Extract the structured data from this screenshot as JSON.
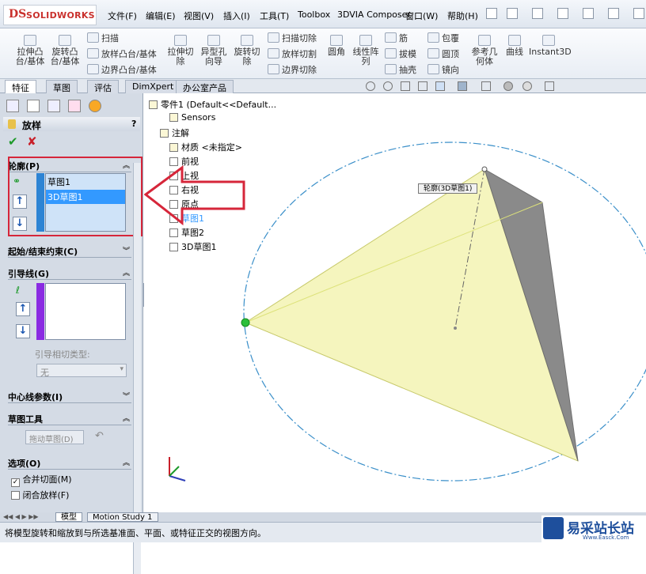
{
  "app": {
    "logo_ds": "DS",
    "logo_text": "SOLIDWORKS"
  },
  "menu": {
    "file": "文件(F)",
    "edit": "编辑(E)",
    "view": "视图(V)",
    "insert": "插入(I)",
    "tools": "工具(T)",
    "toolbox": "Toolbox",
    "dvia": "3DVIA Composer",
    "window": "窗口(W)",
    "help": "帮助(H)"
  },
  "ribbon": {
    "boss_extrude": "拉伸凸\n台/基体",
    "revolve_boss": "旋转凸\n台/基体",
    "sweep": "扫描",
    "loft_boss": "放样凸台/基体",
    "boundary_boss": "边界凸台/基体",
    "extrude_cut": "拉伸切\n除",
    "hole_wizard": "异型孔\n向导",
    "revolve_cut": "旋转切\n除",
    "sweep_cut": "扫描切除",
    "loft_cut": "放样切割",
    "boundary_cut": "边界切除",
    "fillet": "圆角",
    "linear_pattern": "线性阵\n列",
    "rib": "筋",
    "draft": "拔模",
    "shell": "抽壳",
    "wrap": "包覆",
    "dome": "圆顶",
    "mirror": "镜向",
    "ref_geometry": "参考几\n何体",
    "curves": "曲线",
    "instant3d": "Instant3D"
  },
  "tabs": [
    "特征",
    "草图",
    "评估",
    "DimXpert",
    "办公室产品"
  ],
  "panel": {
    "title": "放样",
    "help": "?",
    "profile_section": "轮廓(P)",
    "profiles": [
      "草图1",
      "3D草图1"
    ],
    "constraint_section": "起始/结束约束(C)",
    "guide_section": "引导线(G)",
    "guide_tangency_label": "引导相切类型:",
    "guide_tangency_value": "无",
    "centerline_section": "中心线参数(I)",
    "sketch_tools_section": "草图工具",
    "drag_sketch": "拖动草图(D)",
    "options_section": "选项(O)",
    "merge_faces": "合并切面(M)",
    "close_loft": "闭合放样(F)"
  },
  "tree": {
    "root": "零件1  (Default<<Default...",
    "items": [
      "Sensors",
      "注解",
      "材质 <未指定>",
      "前视",
      "上视",
      "右视",
      "原点",
      "草图1",
      "草图2",
      "3D草图1"
    ]
  },
  "viewport": {
    "callout": "轮廓(3D草图1)"
  },
  "bottom_tabs": [
    "模型",
    "Motion Study 1"
  ],
  "status": "将模型旋转和缩放到与所选基准面、平面、或特征正交的视图方向。",
  "watermark": {
    "brand": "易采站长站",
    "sub": "Www.Easck.Com"
  },
  "colors": {
    "highlight": "#d6263a",
    "selection": "#3399ff",
    "loft_fill": "#f3f3b8"
  }
}
